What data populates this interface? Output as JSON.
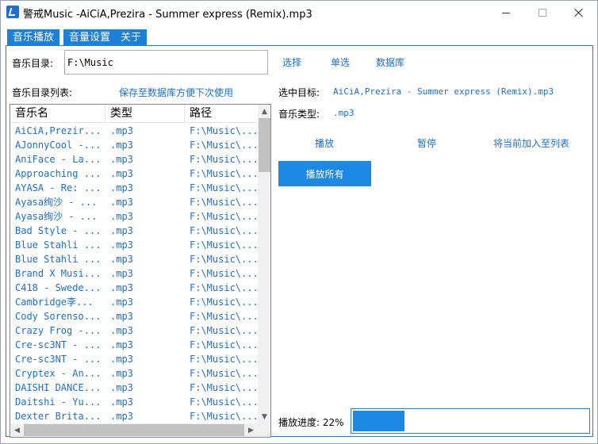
{
  "window": {
    "title": "警戒Music  -AiCiA,Prezira - Summer express (Remix).mp3"
  },
  "tabs": [
    {
      "label": "音乐播放"
    },
    {
      "label": "音量设置"
    },
    {
      "label": "关于"
    }
  ],
  "directory": {
    "label": "音乐目录:",
    "value": "F:\\Music",
    "choose_label": "选择",
    "single_label": "单选",
    "database_label": "数据库"
  },
  "list_section": {
    "label": "音乐目录列表:",
    "save_hint": "保存至数据库方便下次使用"
  },
  "table": {
    "columns": [
      "音乐名",
      "类型",
      "路径"
    ],
    "rows": [
      [
        "AiCiA,Prezir...",
        ".mp3",
        "F:\\Music\\..."
      ],
      [
        "AJonnyCool -...",
        ".mp3",
        "F:\\Music\\..."
      ],
      [
        "AniFace - La...",
        ".mp3",
        "F:\\Music\\..."
      ],
      [
        "Approaching ...",
        ".mp3",
        "F:\\Music\\..."
      ],
      [
        "AYASA - Re: ...",
        ".mp3",
        "F:\\Music\\..."
      ],
      [
        "Ayasa绚沙 - ...",
        ".mp3",
        "F:\\Music\\..."
      ],
      [
        "Ayasa绚沙 - ...",
        ".mp3",
        "F:\\Music\\..."
      ],
      [
        "Bad Style - ...",
        ".mp3",
        "F:\\Music\\..."
      ],
      [
        "Blue Stahli ...",
        ".mp3",
        "F:\\Music\\..."
      ],
      [
        "Blue Stahli ...",
        ".mp3",
        "F:\\Music\\..."
      ],
      [
        "Brand X Musi...",
        ".mp3",
        "F:\\Music\\..."
      ],
      [
        "C418 - Swede...",
        ".mp3",
        "F:\\Music\\..."
      ],
      [
        "Cambridge李...",
        ".mp3",
        "F:\\Music\\..."
      ],
      [
        "Cody Sorenso...",
        ".mp3",
        "F:\\Music\\..."
      ],
      [
        "Crazy Frog -...",
        ".mp3",
        "F:\\Music\\..."
      ],
      [
        "Cre-sc3NT - ...",
        ".mp3",
        "F:\\Music\\..."
      ],
      [
        "Cre-sc3NT - ...",
        ".mp3",
        "F:\\Music\\..."
      ],
      [
        "Cryptex - An...",
        ".mp3",
        "F:\\Music\\..."
      ],
      [
        "DAISHI DANCE...",
        ".mp3",
        "F:\\Music\\..."
      ],
      [
        "Daitshi - Yu...",
        ".mp3",
        "F:\\Music\\..."
      ],
      [
        "Dexter Brita...",
        ".mp3",
        "F:\\Music\\..."
      ]
    ]
  },
  "selection": {
    "target_label": "选中目标:",
    "target_value": "AiCiA,Prezira - Summer express (Remix).mp3",
    "type_label": "音乐类型:",
    "type_value": ".mp3"
  },
  "controls": {
    "play_label": "播放",
    "pause_label": "暂停",
    "add_label": "将当前加入至列表",
    "play_all_label": "播放所有"
  },
  "progress": {
    "label": "播放进度: 22%",
    "value": 0.22
  },
  "colors": {
    "accent": "#1e88e5",
    "link": "#1e6fd1"
  }
}
